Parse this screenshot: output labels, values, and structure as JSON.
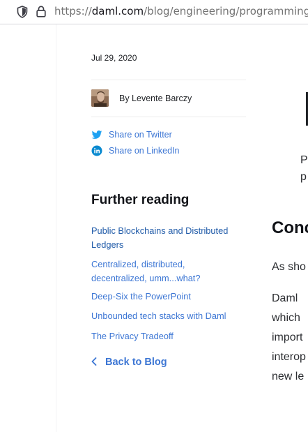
{
  "browser": {
    "url_prefix": "https://",
    "url_domain": "daml.com",
    "url_path": "/blog/engineering/programming-sm"
  },
  "post": {
    "date": "Jul 29, 2020",
    "author": "By Levente Barczy",
    "share": [
      {
        "label": "Share on Twitter",
        "icon": "twitter-icon",
        "color": "#1da1f2"
      },
      {
        "label": "Share on LinkedIn",
        "icon": "linkedin-icon",
        "color": "#0a8ad0"
      }
    ]
  },
  "further_reading": {
    "title": "Further reading",
    "links": [
      "Public Blockchains and Distributed Ledgers",
      "Centralized, distributed, decentralized, umm...what?",
      "Deep-Six the PowerPoint",
      "Unbounded tech stacks with Daml",
      "The Privacy Tradeoff"
    ],
    "back_label": "Back to Blog"
  },
  "article_fragments": {
    "p_line1": "P",
    "p_line2": "p",
    "heading": "Conc",
    "line1": "As sho",
    "line2": "Daml",
    "line3": "which",
    "line4": "import",
    "line5": "interop",
    "line6": "new le"
  },
  "colors": {
    "link": "#3c76d4",
    "accent": "#1da1f2"
  }
}
